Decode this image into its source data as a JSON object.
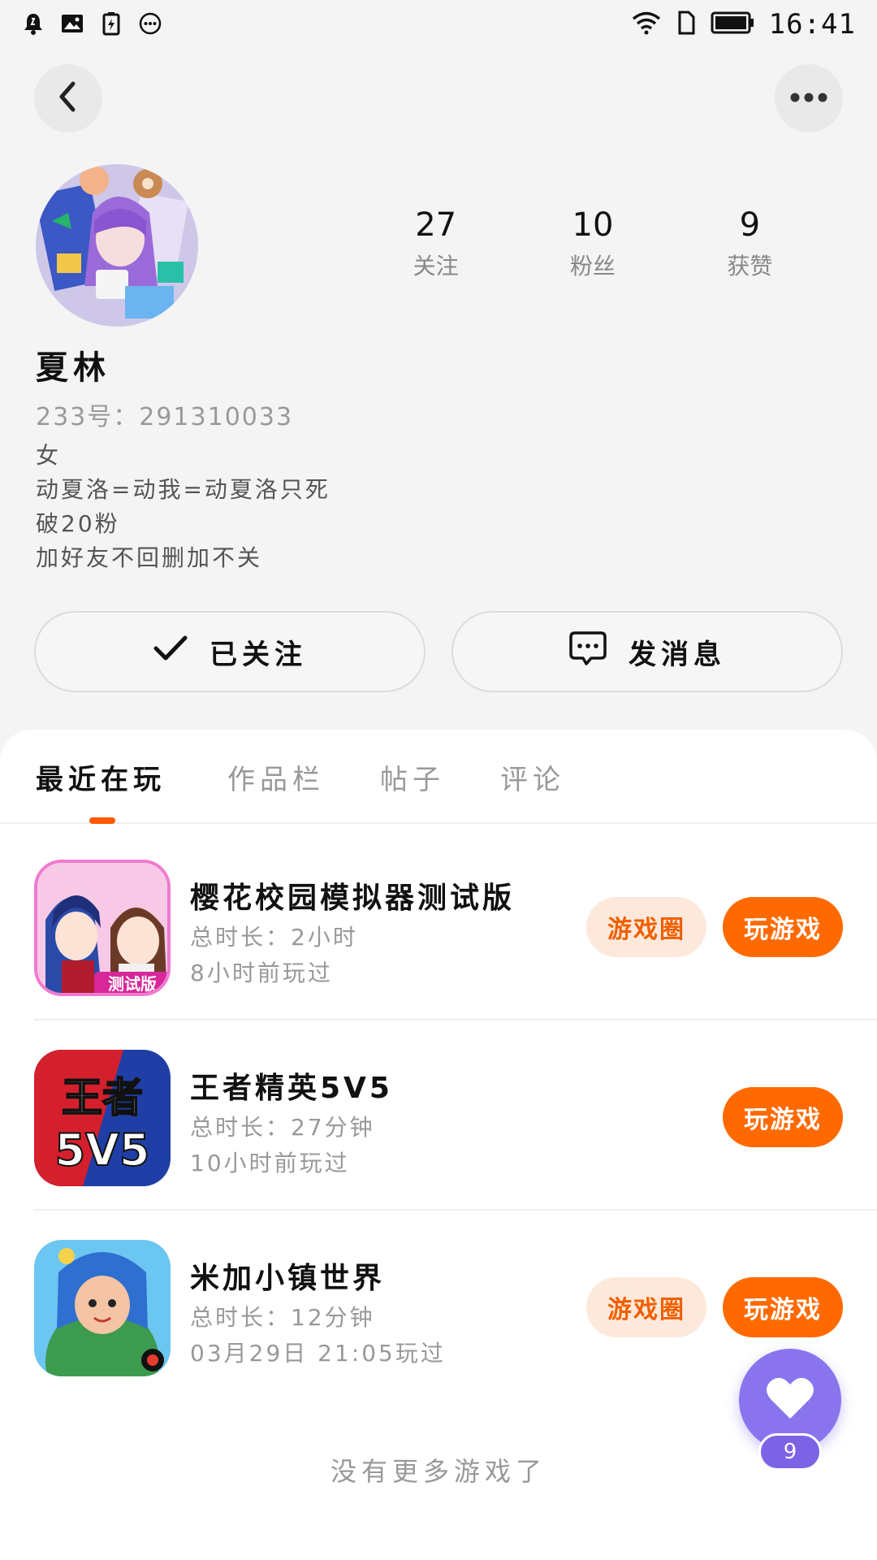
{
  "status_bar": {
    "time": "16:41",
    "left_icons": [
      "alarm-bell-icon",
      "image-icon",
      "battery-saver-icon",
      "more-dots-icon"
    ],
    "right_icons": [
      "wifi-icon",
      "sim-icon",
      "battery-icon"
    ]
  },
  "profile": {
    "name": "夏林",
    "uid": "233号：291310033",
    "stats": [
      {
        "value": "27",
        "label": "关注"
      },
      {
        "value": "10",
        "label": "粉丝"
      },
      {
        "value": "9",
        "label": "获赞"
      }
    ],
    "bio": [
      "女",
      "动夏洛=动我=动夏洛只死",
      "破20粉",
      "加好友不回删加不关"
    ]
  },
  "actions": {
    "follow_label": "已关注",
    "message_label": "发消息"
  },
  "tabs": [
    {
      "label": "最近在玩",
      "active": true
    },
    {
      "label": "作品栏",
      "active": false
    },
    {
      "label": "帖子",
      "active": false
    },
    {
      "label": "评论",
      "active": false
    }
  ],
  "games": [
    {
      "title": "樱花校园模拟器测试版",
      "duration": "总时长：2小时",
      "last_played": "8小时前玩过",
      "circle_label": "游戏圈",
      "play_label": "玩游戏",
      "icon_badge": "测试版"
    },
    {
      "title": "王者精英5V5",
      "duration": "总时长：27分钟",
      "last_played": "10小时前玩过",
      "circle_label": "",
      "play_label": "玩游戏",
      "icon_text_1": "王者",
      "icon_text_2": "5V5"
    },
    {
      "title": "米加小镇世界",
      "duration": "总时长：12分钟",
      "last_played": "03月29日 21:05玩过",
      "circle_label": "游戏圈",
      "play_label": "玩游戏"
    }
  ],
  "footer": {
    "no_more": "没有更多游戏了"
  },
  "like_fab": {
    "count": "9"
  },
  "colors": {
    "accent": "#ff6a00",
    "accent_light": "#fde9dc",
    "fab": "#8a74ee"
  }
}
